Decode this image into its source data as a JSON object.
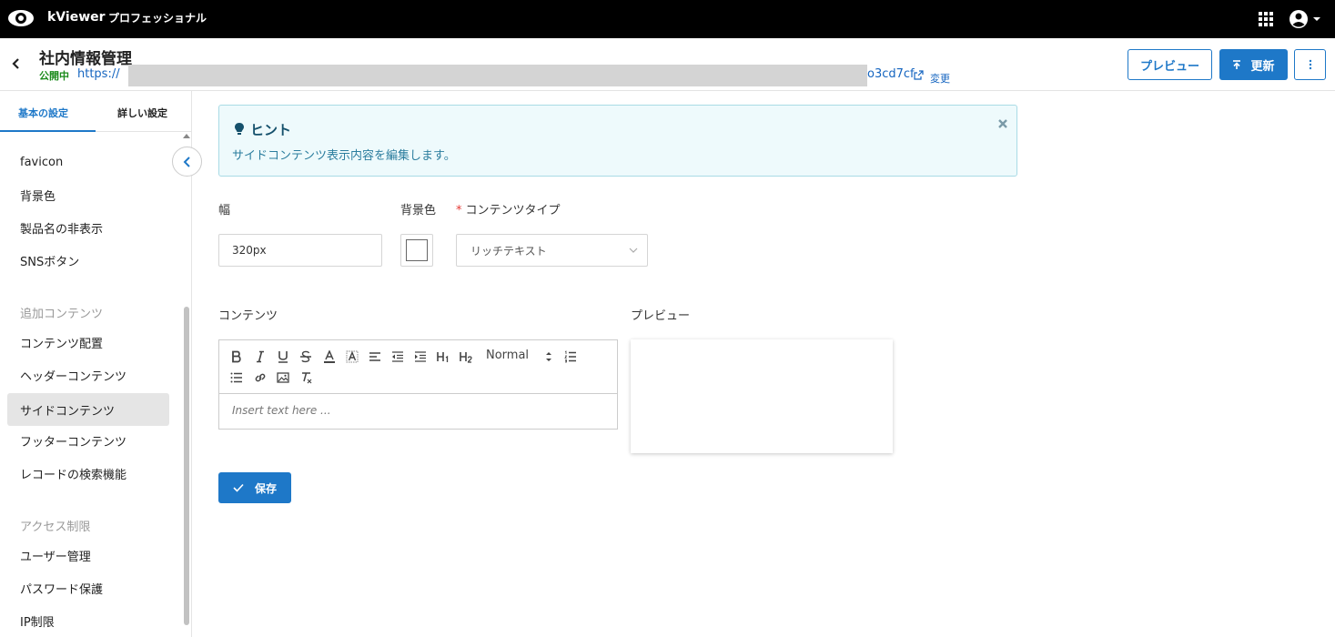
{
  "topbar": {
    "brand": "kViewer",
    "edition": "プロフェッショナル",
    "apps_icon": "grid-apps-icon",
    "account_icon": "account-circle-icon"
  },
  "header": {
    "title": "社内情報管理",
    "status": "公開中",
    "url_prefix": "https://",
    "url_suffix": "o3cd7cf",
    "change_label": "変更",
    "preview_label": "プレビュー",
    "update_label": "更新"
  },
  "sidebar": {
    "tabs": [
      "基本の設定",
      "詳しい設定"
    ],
    "items": [
      {
        "label": "favicon"
      },
      {
        "label": "背景色"
      },
      {
        "label": "製品名の非表示"
      },
      {
        "label": "SNSボタン"
      }
    ],
    "section_additional": "追加コンテンツ",
    "additional_items": [
      {
        "label": "コンテンツ配置"
      },
      {
        "label": "ヘッダーコンテンツ"
      },
      {
        "label": "サイドコンテンツ"
      },
      {
        "label": "フッターコンテンツ"
      },
      {
        "label": "レコードの検索機能"
      }
    ],
    "section_access": "アクセス制限",
    "access_items": [
      {
        "label": "ユーザー管理"
      },
      {
        "label": "パスワード保護"
      },
      {
        "label": "IP制限"
      }
    ]
  },
  "hint": {
    "title": "ヒント",
    "text": "サイドコンテンツ表示内容を編集します。"
  },
  "form": {
    "width_label": "幅",
    "width_value": "320px",
    "bg_label": "背景色",
    "bg_value": "#ffffff",
    "type_label": "コンテンツタイプ",
    "type_value": "リッチテキスト",
    "content_label": "コンテンツ",
    "preview_label": "プレビュー",
    "editor_format": "Normal",
    "editor_placeholder": "Insert text here ...",
    "save_label": "保存"
  },
  "colors": {
    "accent": "#1e78c8",
    "status_green": "#1a8a1a",
    "hint_bg": "#eefafc"
  }
}
